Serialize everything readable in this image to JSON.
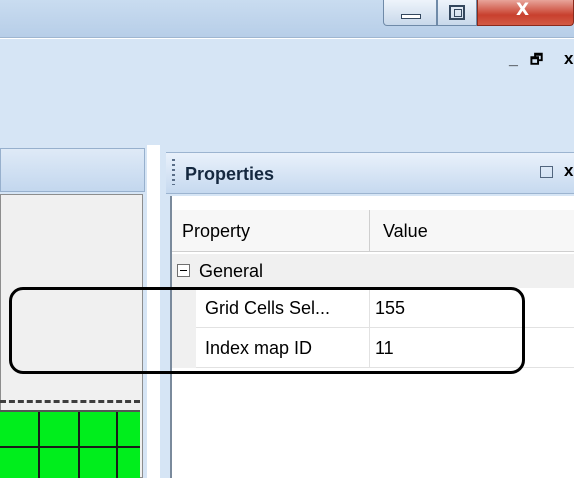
{
  "window": {
    "controls": {
      "minimize_icon": "minimize-icon",
      "maximize_icon": "restore-window-icon",
      "close_icon": "close-icon",
      "close_glyph": "X"
    }
  },
  "mdi": {
    "minimize_glyph": "_",
    "restore_glyph": "🗗",
    "close_glyph": "x"
  },
  "properties": {
    "title": "Properties",
    "close_glyph": "x",
    "columns": {
      "property": "Property",
      "value": "Value"
    },
    "group": {
      "label": "General",
      "expanded": true
    },
    "rows": [
      {
        "name": "Grid Cells Sel...",
        "value": "155"
      },
      {
        "name": "Index map ID",
        "value": "11"
      }
    ]
  },
  "colors": {
    "accent": "#d6e5f5",
    "grid_fill": "#00ee1c",
    "close_button": "#c8402e",
    "highlight_outline": "#000000"
  }
}
